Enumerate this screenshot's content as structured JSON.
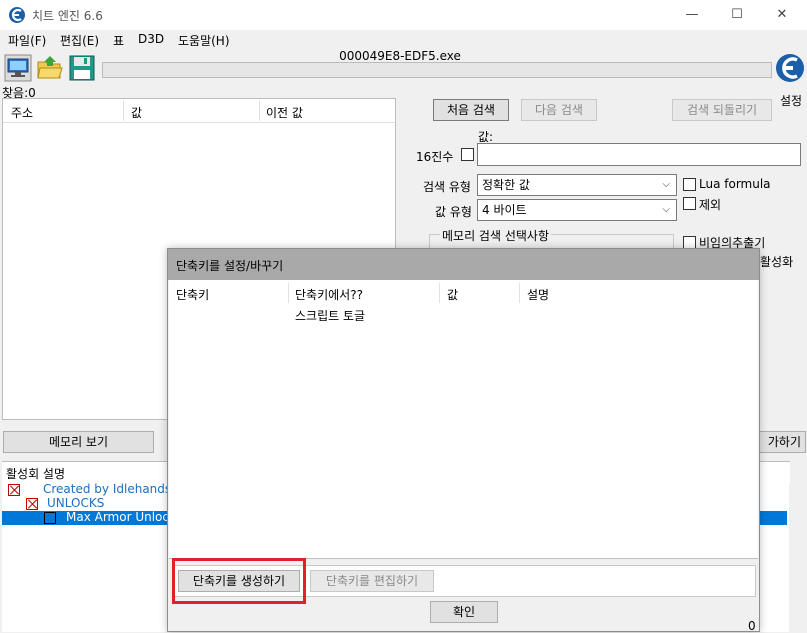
{
  "window": {
    "title": "치트 엔진 6.6",
    "controls": {
      "minimize": "—",
      "maximize": "☐",
      "close": "✕"
    }
  },
  "menu": [
    "파일(F)",
    "편집(E)",
    "표",
    "D3D",
    "도움말(H)"
  ],
  "process_name": "000049E8-EDF5.exe",
  "settings_label": "설정",
  "found_label": "찾음:0",
  "address_list": {
    "columns": [
      "주소",
      "값",
      "이전 값"
    ]
  },
  "scan": {
    "first_scan": "처음 검색",
    "next_scan": "다음 검색",
    "undo_scan": "검색 되돌리기",
    "value_label": "값:",
    "hex_label": "16진수",
    "value_input": "",
    "scan_type_label": "검색 유형",
    "scan_type_value": "정확한 값",
    "value_type_label": "값 유형",
    "value_type_value": "4 바이트",
    "lua_formula": "Lua formula",
    "exclude": "제외",
    "memory_scan_options": "메모리 검색 선택사항",
    "unrandomizer": "비임의추출기",
    "activate_partial": "활성화"
  },
  "memory_view_button": "메모리 보기",
  "add_address_partial": "가하기",
  "cheat_table": {
    "header": "활성회 설명",
    "rows": [
      {
        "label": "Created by Idlehands",
        "indent": 1
      },
      {
        "label": "UNLOCKS",
        "indent": 2
      },
      {
        "label": "Max Armor Unloc",
        "indent": 3,
        "selected": true
      }
    ]
  },
  "dialog": {
    "title": "단축키를 설정/바꾸기",
    "columns": [
      "단축키",
      "단축키에서??",
      "값",
      "설명"
    ],
    "rows": [
      {
        "hotkey": "",
        "action": "스크립트 토글",
        "value": "",
        "description": ""
      }
    ],
    "create_button": "단축키를 생성하기",
    "edit_button": "단축키를 편집하기",
    "ok_button": "확인",
    "status_value": "0"
  },
  "colors": {
    "highlight": "#e0202a",
    "selection": "#0078d7",
    "link_text": "#1b6fc0",
    "dialog_title_bg": "#a9a9a9"
  },
  "icons": [
    "cheat-engine-app-icon",
    "computer-monitor-icon",
    "open-folder-icon",
    "save-disk-icon",
    "cheat-engine-logo-icon"
  ]
}
